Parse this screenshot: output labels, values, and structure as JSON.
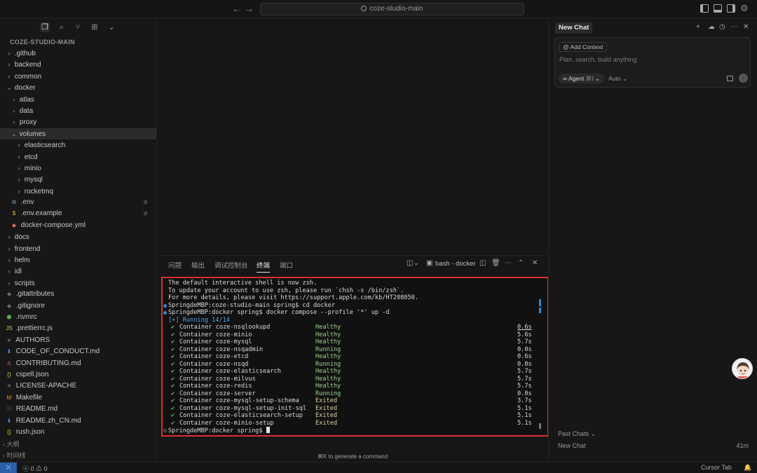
{
  "titlebar": {
    "back_icon": "arrow-left-icon",
    "forward_icon": "arrow-right-icon",
    "search_text": "coze-studio-main"
  },
  "sidebar": {
    "project_title": "COZE-STUDIO-MAIN",
    "tree": [
      {
        "label": ".github",
        "depth": 0,
        "kind": "folder",
        "open": false
      },
      {
        "label": "backend",
        "depth": 0,
        "kind": "folder",
        "open": false
      },
      {
        "label": "common",
        "depth": 0,
        "kind": "folder",
        "open": false
      },
      {
        "label": "docker",
        "depth": 0,
        "kind": "folder",
        "open": true
      },
      {
        "label": "atlas",
        "depth": 1,
        "kind": "folder",
        "open": false
      },
      {
        "label": "data",
        "depth": 1,
        "kind": "folder",
        "open": false
      },
      {
        "label": "proxy",
        "depth": 1,
        "kind": "folder",
        "open": false
      },
      {
        "label": "volumes",
        "depth": 1,
        "kind": "folder",
        "open": true,
        "selected": true
      },
      {
        "label": "elasticsearch",
        "depth": 2,
        "kind": "folder",
        "open": false
      },
      {
        "label": "etcd",
        "depth": 2,
        "kind": "folder",
        "open": false
      },
      {
        "label": "minio",
        "depth": 2,
        "kind": "folder",
        "open": false
      },
      {
        "label": "mysql",
        "depth": 2,
        "kind": "folder",
        "open": false
      },
      {
        "label": "rocketmq",
        "depth": 2,
        "kind": "folder",
        "open": false
      },
      {
        "label": ".env",
        "depth": 1,
        "kind": "file",
        "icon": "⚙",
        "icon_color": "#7f9fb8",
        "ignored": true
      },
      {
        "label": ".env.example",
        "depth": 1,
        "kind": "file",
        "icon": "$",
        "icon_color": "#d6b94a",
        "ignored": true
      },
      {
        "label": "docker-compose.yml",
        "depth": 1,
        "kind": "file",
        "icon": "◆",
        "icon_color": "#d96a6a"
      },
      {
        "label": "docs",
        "depth": 0,
        "kind": "folder",
        "open": false
      },
      {
        "label": "frontend",
        "depth": 0,
        "kind": "folder",
        "open": false
      },
      {
        "label": "helm",
        "depth": 0,
        "kind": "folder",
        "open": false
      },
      {
        "label": "idl",
        "depth": 0,
        "kind": "folder",
        "open": false
      },
      {
        "label": "scripts",
        "depth": 0,
        "kind": "folder",
        "open": false
      },
      {
        "label": ".gitattributes",
        "depth": 0,
        "kind": "file",
        "icon": "◈",
        "icon_color": "#8a8a8a"
      },
      {
        "label": ".gitignore",
        "depth": 0,
        "kind": "file",
        "icon": "◈",
        "icon_color": "#8a8a8a"
      },
      {
        "label": ".nvmrc",
        "depth": 0,
        "kind": "file",
        "icon": "⬢",
        "icon_color": "#5ea64f"
      },
      {
        "label": ".prettierrc.js",
        "depth": 0,
        "kind": "file",
        "icon": "JS",
        "icon_color": "#d6c34a"
      },
      {
        "label": "AUTHORS",
        "depth": 0,
        "kind": "file",
        "icon": "≡",
        "icon_color": "#a0a0a0"
      },
      {
        "label": "CODE_OF_CONDUCT.md",
        "depth": 0,
        "kind": "file",
        "icon": "⬇",
        "icon_color": "#4a8fd6"
      },
      {
        "label": "CONTRIBUTING.md",
        "depth": 0,
        "kind": "file",
        "icon": "♙",
        "icon_color": "#d96a6a"
      },
      {
        "label": "cspell.json",
        "depth": 0,
        "kind": "file",
        "icon": "{}",
        "icon_color": "#d6c34a"
      },
      {
        "label": "LICENSE-APACHE",
        "depth": 0,
        "kind": "file",
        "icon": "≡",
        "icon_color": "#a0a0a0"
      },
      {
        "label": "Makefile",
        "depth": 0,
        "kind": "file",
        "icon": "M",
        "icon_color": "#e08a3c"
      },
      {
        "label": "README.md",
        "depth": 0,
        "kind": "file",
        "icon": "ⓘ",
        "icon_color": "#4a8fd6"
      },
      {
        "label": "README.zh_CN.md",
        "depth": 0,
        "kind": "file",
        "icon": "⬇",
        "icon_color": "#4a8fd6"
      },
      {
        "label": "rush.json",
        "depth": 0,
        "kind": "file",
        "icon": "{}",
        "icon_color": "#d6c34a"
      }
    ],
    "outline_label": "大纲",
    "timeline_label": "时间线"
  },
  "panel": {
    "tabs": [
      "问题",
      "输出",
      "调试控制台",
      "终端",
      "端口"
    ],
    "active_tab": 3,
    "terminal_name": "bash - docker",
    "cmd_hint": "⌘K to generate a command"
  },
  "terminal": {
    "intro": [
      "The default interactive shell is now zsh.",
      "To update your account to use zsh, please run `chsh -s /bin/zsh`.",
      "For more details, please visit https://support.apple.com/kb/HT208050."
    ],
    "prompt1": "SpringdeMBP:coze-studio-main spring$ cd docker",
    "prompt2": "SpringdeMBP:docker spring$ docker compose --profile '*' up -d",
    "running": "[+] Running 14/14",
    "containers": [
      {
        "name": "Container coze-nsqlookupd",
        "status": "Healthy",
        "time": "0.6s",
        "underline": true
      },
      {
        "name": "Container coze-minio",
        "status": "Healthy",
        "time": "5.6s"
      },
      {
        "name": "Container coze-mysql",
        "status": "Healthy",
        "time": "5.7s"
      },
      {
        "name": "Container coze-nsqadmin",
        "status": "Running",
        "time": "0.0s"
      },
      {
        "name": "Container coze-etcd",
        "status": "Healthy",
        "time": "0.6s"
      },
      {
        "name": "Container coze-nsqd",
        "status": "Running",
        "time": "0.0s"
      },
      {
        "name": "Container coze-elasticsearch",
        "status": "Healthy",
        "time": "5.7s"
      },
      {
        "name": "Container coze-milvus",
        "status": "Healthy",
        "time": "5.7s"
      },
      {
        "name": "Container coze-redis",
        "status": "Healthy",
        "time": "5.7s"
      },
      {
        "name": "Container coze-server",
        "status": "Running",
        "time": "0.0s"
      },
      {
        "name": "Container coze-mysql-setup-schema",
        "status": "Exited",
        "time": "3.7s"
      },
      {
        "name": "Container coze-mysql-setup-init-sql",
        "status": "Exited",
        "time": "5.1s"
      },
      {
        "name": "Container coze-elasticsearch-setup",
        "status": "Exited",
        "time": "5.1s"
      },
      {
        "name": "Container coze-minio-setup",
        "status": "Exited",
        "time": "5.1s"
      }
    ],
    "prompt3": "SpringdeMBP:docker spring$ "
  },
  "chat": {
    "tab_label": "New Chat",
    "add_context": "Add Context",
    "placeholder": "Plan, search, build anything",
    "agent_label": "Agent",
    "agent_shortcut": "⌘I",
    "model_label": "Auto",
    "past_chats_label": "Past Chats",
    "past_items": [
      {
        "title": "New Chat",
        "when": "41m"
      }
    ]
  },
  "statusbar": {
    "errors": "0",
    "warnings": "0",
    "cursor_tab": "Cursor Tab"
  },
  "colors": {
    "accent_blue": "#2e8bcf",
    "highlight_border": "#d9302c"
  }
}
